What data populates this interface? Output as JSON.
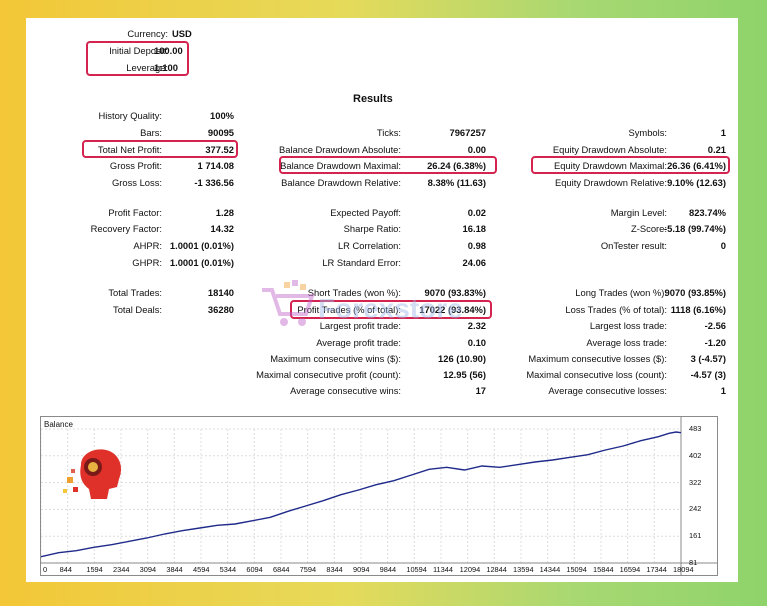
{
  "header": {
    "currency": {
      "label": "Currency:",
      "value": "USD"
    },
    "initial_deposit": {
      "label": "Initial Deposit:",
      "value": "100.00"
    },
    "leverage": {
      "label": "Leverage:",
      "value": "1:100"
    }
  },
  "results_title": "Results",
  "col1": [
    {
      "label": "History Quality:",
      "value": "100%"
    },
    {
      "label": "Bars:",
      "value": "90095"
    },
    {
      "label": "Total Net Profit:",
      "value": "377.52"
    },
    {
      "label": "Gross Profit:",
      "value": "1 714.08"
    },
    {
      "label": "Gross Loss:",
      "value": "-1 336.56"
    },
    {
      "label": "Profit Factor:",
      "value": "1.28"
    },
    {
      "label": "Recovery Factor:",
      "value": "14.32"
    },
    {
      "label": "AHPR:",
      "value": "1.0001 (0.01%)"
    },
    {
      "label": "GHPR:",
      "value": "1.0001 (0.01%)"
    },
    {
      "label": "Total Trades:",
      "value": "18140"
    },
    {
      "label": "Total Deals:",
      "value": "36280"
    }
  ],
  "col2": [
    {
      "label": "Ticks:",
      "value": "7967257"
    },
    {
      "label": "Balance Drawdown Absolute:",
      "value": "0.00"
    },
    {
      "label": "Balance Drawdown Maximal:",
      "value": "26.24 (6.38%)"
    },
    {
      "label": "Balance Drawdown Relative:",
      "value": "8.38% (11.63)"
    },
    {
      "label": "Expected Payoff:",
      "value": "0.02"
    },
    {
      "label": "Sharpe Ratio:",
      "value": "16.18"
    },
    {
      "label": "LR Correlation:",
      "value": "0.98"
    },
    {
      "label": "LR Standard Error:",
      "value": "24.06"
    },
    {
      "label": "Short Trades (won %):",
      "value": "9070 (93.83%)"
    },
    {
      "label": "Profit Trades (% of total):",
      "value": "17022 (93.84%)"
    },
    {
      "label": "Largest profit trade:",
      "value": "2.32"
    },
    {
      "label": "Average profit trade:",
      "value": "0.10"
    },
    {
      "label": "Maximum consecutive wins ($):",
      "value": "126 (10.90)"
    },
    {
      "label": "Maximal consecutive profit (count):",
      "value": "12.95 (56)"
    },
    {
      "label": "Average consecutive wins:",
      "value": "17"
    }
  ],
  "col3": [
    {
      "label": "Symbols:",
      "value": "1"
    },
    {
      "label": "Equity Drawdown Absolute:",
      "value": "0.21"
    },
    {
      "label": "Equity Drawdown Maximal:",
      "value": "26.36 (6.41%)"
    },
    {
      "label": "Equity Drawdown Relative:",
      "value": "9.10% (12.63)"
    },
    {
      "label": "Margin Level:",
      "value": "823.74%"
    },
    {
      "label": "Z-Score:",
      "value": "-5.18 (99.74%)"
    },
    {
      "label": "OnTester result:",
      "value": "0"
    },
    {
      "label": "Long Trades (won %):",
      "value": "9070 (93.85%)"
    },
    {
      "label": "Loss Trades (% of total):",
      "value": "1118 (6.16%)"
    },
    {
      "label": "Largest loss trade:",
      "value": "-2.56"
    },
    {
      "label": "Average loss trade:",
      "value": "-1.20"
    },
    {
      "label": "Maximum consecutive losses ($):",
      "value": "3 (-4.57)"
    },
    {
      "label": "Maximal consecutive loss (count):",
      "value": "-4.57 (3)"
    },
    {
      "label": "Average consecutive losses:",
      "value": "1"
    }
  ],
  "watermark_text": "Forexstore",
  "colors": {
    "highlight": "#d4234e",
    "line": "#1f2a8a",
    "bg_left": "#f3c737",
    "bg_right": "#8fd36b"
  },
  "chart_data": {
    "type": "line",
    "title": "Balance",
    "x_ticks": [
      "0",
      "844",
      "1594",
      "2344",
      "3094",
      "3844",
      "4594",
      "5344",
      "6094",
      "6844",
      "7594",
      "8344",
      "9094",
      "9844",
      "10594",
      "11344",
      "12094",
      "12844",
      "13594",
      "14344",
      "15094",
      "15844",
      "16594",
      "17344",
      "18094"
    ],
    "y_ticks": [
      "483",
      "402",
      "322",
      "242",
      "161",
      "81"
    ],
    "ylim": [
      81,
      483
    ],
    "xlim": [
      0,
      18140
    ],
    "series": [
      {
        "values": [
          [
            0,
            100
          ],
          [
            500,
            112
          ],
          [
            1000,
            118
          ],
          [
            1500,
            128
          ],
          [
            2000,
            136
          ],
          [
            2500,
            146
          ],
          [
            3000,
            156
          ],
          [
            3500,
            168
          ],
          [
            4000,
            178
          ],
          [
            4500,
            186
          ],
          [
            5000,
            194
          ],
          [
            5500,
            198
          ],
          [
            6000,
            208
          ],
          [
            6500,
            218
          ],
          [
            7000,
            236
          ],
          [
            7500,
            252
          ],
          [
            8000,
            268
          ],
          [
            8500,
            286
          ],
          [
            9000,
            300
          ],
          [
            9500,
            316
          ],
          [
            10000,
            328
          ],
          [
            10500,
            345
          ],
          [
            11000,
            362
          ],
          [
            11500,
            368
          ],
          [
            12000,
            360
          ],
          [
            12500,
            372
          ],
          [
            13000,
            368
          ],
          [
            13500,
            376
          ],
          [
            14000,
            384
          ],
          [
            14500,
            390
          ],
          [
            15000,
            398
          ],
          [
            15500,
            406
          ],
          [
            16000,
            420
          ],
          [
            16500,
            432
          ],
          [
            17000,
            448
          ],
          [
            17500,
            460
          ],
          [
            17800,
            470
          ],
          [
            18000,
            474
          ],
          [
            18140,
            472
          ]
        ]
      }
    ]
  }
}
